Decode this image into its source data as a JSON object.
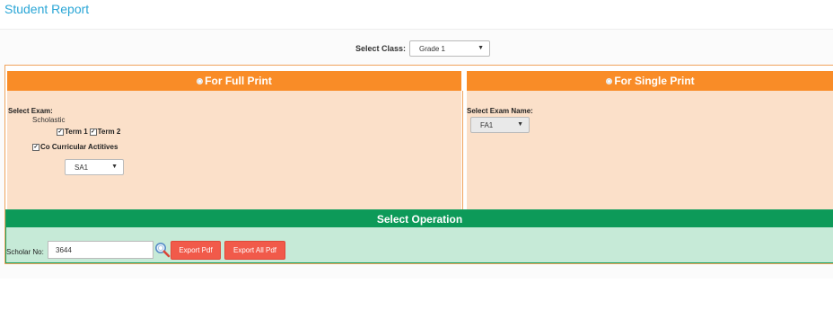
{
  "page": {
    "title": "Student Report"
  },
  "class_filter": {
    "label": "Select Class:",
    "value": "Grade 1"
  },
  "full_print": {
    "header": "For Full Print",
    "select_exam_label": "Select Exam:",
    "scholastic_label": "Scholastic",
    "term1_label": "Term 1",
    "term2_label": "Term 2",
    "co_curricular_label": "Co Curricular Actitives",
    "exam_select_value": "SA1",
    "checked": {
      "term1": true,
      "term2": true,
      "co_curricular": true
    }
  },
  "single_print": {
    "header": "For Single Print",
    "select_exam_name_label": "Select Exam Name:",
    "exam_name_value": "FA1"
  },
  "operation": {
    "header": "Select Operation",
    "scholar_label": "Scholar No:",
    "scholar_value": "3644",
    "export_pdf_label": "Export Pdf",
    "export_all_pdf_label": "Export All Pdf"
  },
  "colors": {
    "accent_title": "#2aa6d6",
    "orange_header": "#f98c27",
    "orange_panel": "#fbe0c9",
    "green_header": "#0d9a59",
    "green_panel": "#c6ead7",
    "button_red": "#f15a4a"
  },
  "icons": {
    "search": "search-icon",
    "caret": "caret-down-icon"
  }
}
